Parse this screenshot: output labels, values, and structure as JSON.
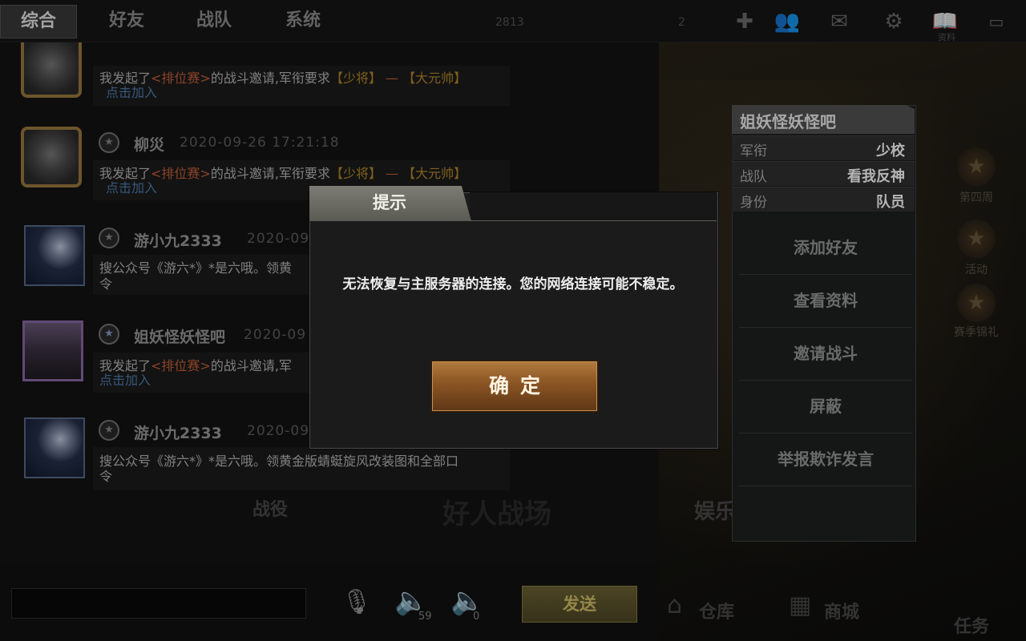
{
  "tabs": [
    "综合",
    "好友",
    "战队",
    "系统"
  ],
  "top_right": {
    "resource_num": "2",
    "coin_text": "2813",
    "label_data": "资料"
  },
  "messages": [
    {
      "name": "",
      "time": "",
      "prefix": "我发起了",
      "mode": "<排位赛>",
      "mid": "的战斗邀请,军衔要求",
      "rank_lo": "【少将】",
      "dash": "—",
      "rank_hi": "【大元帅】",
      "join": "点击加入"
    },
    {
      "name": "柳災",
      "time": "2020-09-26 17:21:18",
      "prefix": "我发起了",
      "mode": "<排位赛>",
      "mid": "的战斗邀请,军衔要求",
      "rank_lo": "【少将】",
      "dash": "—",
      "rank_hi": "【大元帅】",
      "join": "点击加入"
    },
    {
      "name": "游小九2333",
      "time": "2020-09",
      "line1": "搜公众号《游六*》*是六哦。领黄",
      "line2": "令"
    },
    {
      "name": "姐妖怪妖怪吧",
      "time": "2020-09",
      "prefix": "我发起了",
      "mode": "<排位赛>",
      "mid": "的战斗邀请,军",
      "join": "点击加入"
    },
    {
      "name": "游小九2333",
      "time": "2020-09",
      "line1": "搜公众号《游六*》*是六哦。领黄金版蜻蜓旋风改装图和全部口",
      "line2": "令"
    }
  ],
  "input": {
    "send": "发送",
    "vol1": "59",
    "vol2": "0"
  },
  "bottom_nav": {
    "battle": "战役",
    "mode": "好人战场",
    "fun": "娱乐",
    "warehouse": "仓库",
    "shop": "商城",
    "task": "任务"
  },
  "side": {
    "s1": "第四周",
    "s2": "活动",
    "s3": "赛季锦礼"
  },
  "profile": {
    "name": "姐妖怪妖怪吧",
    "rows": [
      {
        "k": "军衔",
        "v": "少校"
      },
      {
        "k": "战队",
        "v": "看我反神"
      },
      {
        "k": "身份",
        "v": "队员"
      }
    ],
    "buttons": [
      "添加好友",
      "查看资料",
      "邀请战斗",
      "屏蔽",
      "举报欺诈发言"
    ]
  },
  "dialog": {
    "title": "提示",
    "message": "无法恢复与主服务器的连接。您的网络连接可能不稳定。",
    "ok": "确定"
  }
}
